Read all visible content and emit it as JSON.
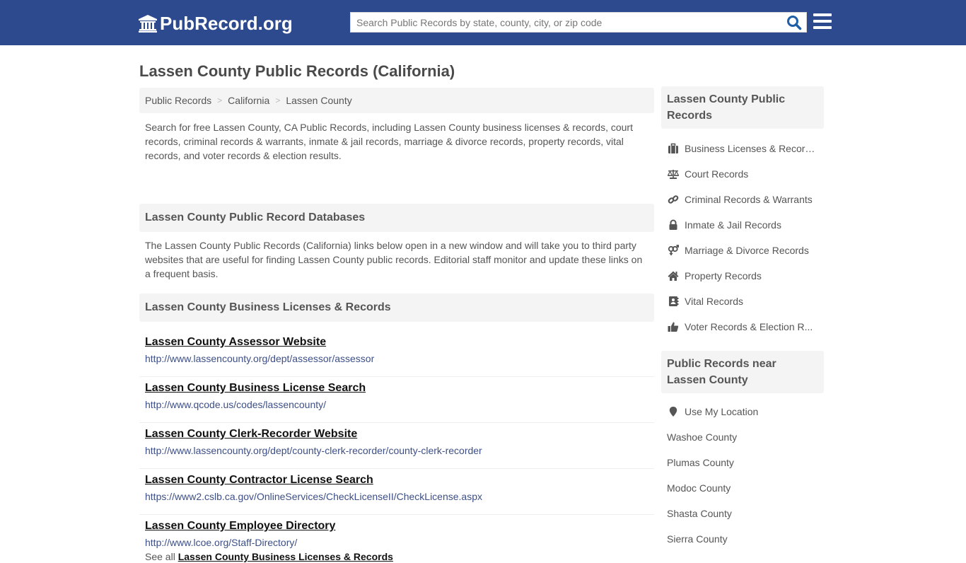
{
  "header": {
    "logo_text": "PubRecord.org",
    "search_placeholder": "Search Public Records by state, county, city, or zip code",
    "search_value": "",
    "colors": {
      "bar": "#2e4a8e",
      "search_icon": "#1f5fa8"
    }
  },
  "page": {
    "title": "Lassen County Public Records (California)"
  },
  "breadcrumb": [
    {
      "label": "Public Records"
    },
    {
      "label": "California"
    },
    {
      "label": "Lassen County"
    }
  ],
  "breadcrumb_separator": ">",
  "intro": "Search for free Lassen County, CA Public Records, including Lassen County business licenses & records, court records, criminal records & warrants, inmate & jail records, marriage & divorce records, property records, vital records, and voter records & election results.",
  "databases": {
    "heading": "Lassen County Public Record Databases",
    "description": "The Lassen County Public Records (California) links below open in a new window and will take you to third party websites that are useful for finding Lassen County public records. Editorial staff monitor and update these links on a frequent basis."
  },
  "business": {
    "heading": "Lassen County Business Licenses & Records",
    "links": [
      {
        "title": "Lassen County Assessor Website",
        "url": "http://www.lassencounty.org/dept/assessor/assessor"
      },
      {
        "title": "Lassen County Business License Search",
        "url": "http://www.qcode.us/codes/lassencounty/"
      },
      {
        "title": "Lassen County Clerk-Recorder Website",
        "url": "http://www.lassencounty.org/dept/county-clerk-recorder/county-clerk-recorder"
      },
      {
        "title": "Lassen County Contractor License Search",
        "url": "https://www2.cslb.ca.gov/OnlineServices/CheckLicenseII/CheckLicense.aspx"
      },
      {
        "title": "Lassen County Employee Directory",
        "url": "http://www.lcoe.org/Staff-Directory/"
      }
    ],
    "see_all_prefix": "See all",
    "see_all_link": "Lassen County Business Licenses & Records"
  },
  "sidebar": {
    "records_heading": "Lassen County Public Records",
    "records": [
      {
        "label": "Business Licenses & Records",
        "icon": "briefcase-icon"
      },
      {
        "label": "Court Records",
        "icon": "balance-scale-icon"
      },
      {
        "label": "Criminal Records & Warrants",
        "icon": "link-icon"
      },
      {
        "label": "Inmate & Jail Records",
        "icon": "lock-icon"
      },
      {
        "label": "Marriage & Divorce Records",
        "icon": "venus-mars-icon"
      },
      {
        "label": "Property Records",
        "icon": "home-icon"
      },
      {
        "label": "Vital Records",
        "icon": "address-book-icon"
      },
      {
        "label": "Voter Records & Election R...",
        "icon": "thumbs-up-icon"
      }
    ],
    "nearby_heading": "Public Records near Lassen County",
    "use_location": {
      "label": "Use My Location",
      "icon": "map-marker-icon"
    },
    "nearby": [
      {
        "label": "Washoe County"
      },
      {
        "label": "Plumas County"
      },
      {
        "label": "Modoc County"
      },
      {
        "label": "Shasta County"
      },
      {
        "label": "Sierra County"
      }
    ]
  }
}
